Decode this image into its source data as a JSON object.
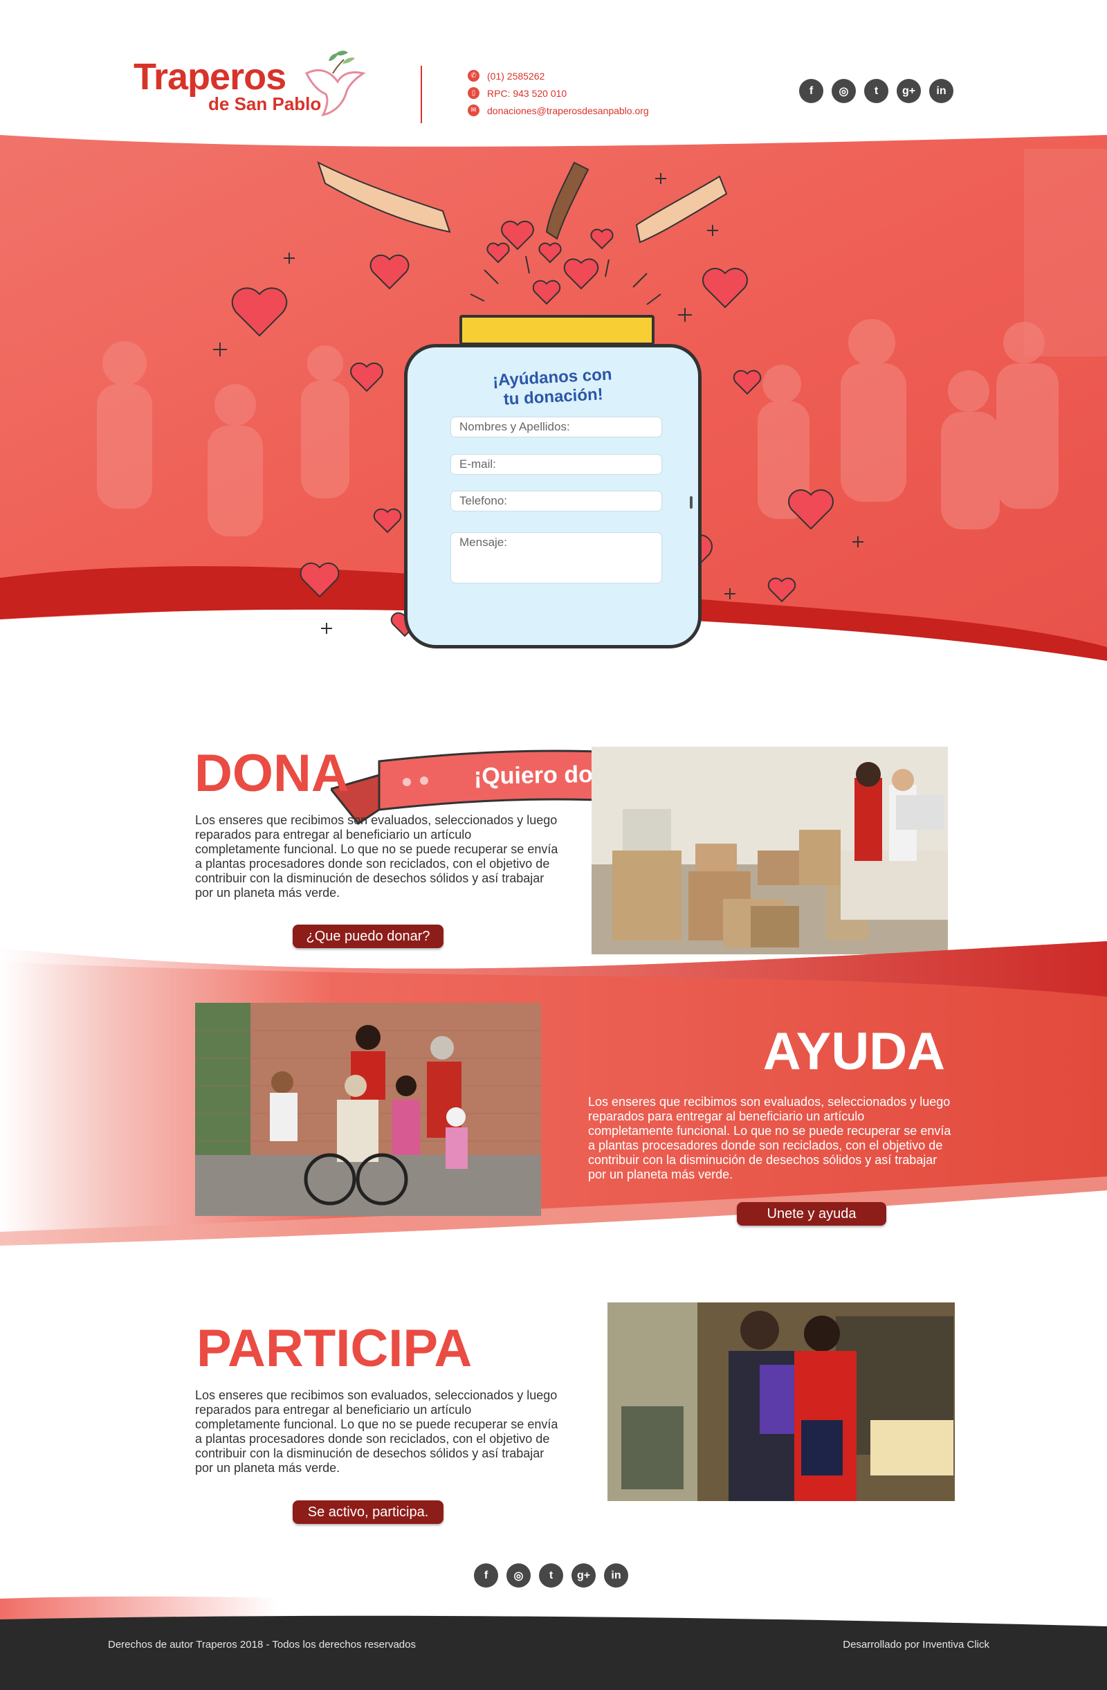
{
  "brand": {
    "name": "Traperos",
    "sub": "de San Pablo"
  },
  "contact": {
    "phone": "(01) 2585262",
    "rpc": "RPC: 943 520 010",
    "email": "donaciones@traperosdesanpablo.org"
  },
  "social": [
    "facebook-icon",
    "instagram-icon",
    "twitter-icon",
    "google-plus-icon",
    "linkedin-icon"
  ],
  "social_glyphs": [
    "f",
    "◎",
    "t",
    "g+",
    "in"
  ],
  "hero": {
    "title_line1": "¡Ayúdanos con",
    "title_line2": "tu donación!",
    "form": {
      "name_placeholder": "Nombres y Apellidos:",
      "email_placeholder": "E-mail:",
      "phone_placeholder": "Telefono:",
      "message_placeholder": "Mensaje:"
    },
    "cta": "¡Quiero donar!"
  },
  "sections": {
    "dona": {
      "title": "DONA",
      "text": "Los enseres que recibimos son evaluados, seleccionados y luego reparados para entregar al beneficiario un artículo completamente funcional. Lo que no se puede recuperar se envía a plantas procesadores donde son reciclados, con el objetivo de contribuir con la disminución de desechos sólidos y así trabajar por un planeta más verde.",
      "button": "¿Que puedo donar?"
    },
    "ayuda": {
      "title": "AYUDA",
      "text": "Los enseres que recibimos son evaluados, seleccionados y luego reparados para entregar al beneficiario un artículo completamente funcional. Lo que no se puede recuperar se envía a plantas procesadores donde son reciclados, con el objetivo de contribuir con la disminución de desechos sólidos y así trabajar por un planeta más verde.",
      "button": "Unete y ayuda"
    },
    "participa": {
      "title": "PARTICIPA",
      "text": "Los enseres que recibimos son evaluados, seleccionados y luego reparados para entregar al beneficiario un artículo completamente funcional. Lo que no se puede recuperar se envía a plantas procesadores donde son reciclados, con el objetivo de contribuir con la disminución de desechos sólidos y así trabajar por un planeta más verde.",
      "button": "Se activo, participa."
    }
  },
  "footer": {
    "copyright": "Derechos de autor Traperos 2018 - Todos los derechos reservados",
    "credit": "Desarrollado por Inventiva Click"
  },
  "colors": {
    "brand_red": "#d8332a",
    "hero_red": "#ef5a50",
    "button_dark": "#8d1d19",
    "footer_dark": "#2a2a2a",
    "jar_blue": "#dbf1fb",
    "lid_yellow": "#f7cf35"
  }
}
